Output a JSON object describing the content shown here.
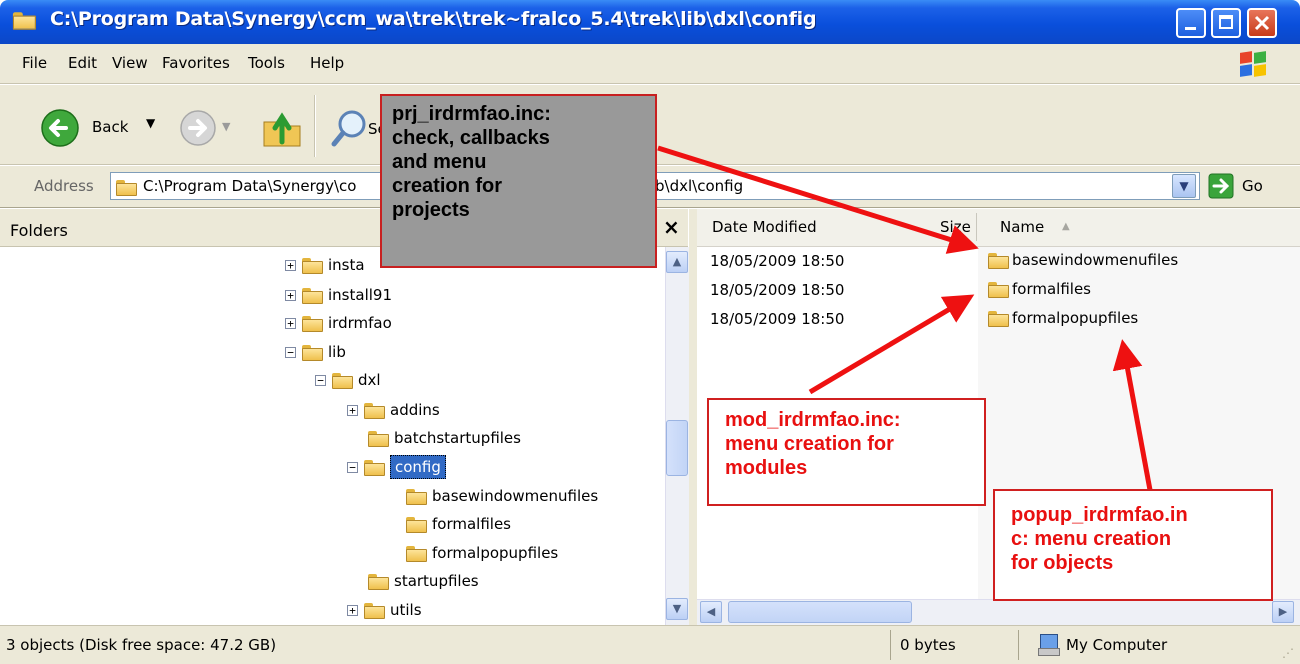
{
  "window": {
    "title": "C:\\Program Data\\Synergy\\ccm_wa\\trek\\trek~fralco_5.4\\trek\\lib\\dxl\\config"
  },
  "menu": [
    "File",
    "Edit",
    "View",
    "Favorites",
    "Tools",
    "Help"
  ],
  "toolbar": {
    "back_label": "Back",
    "search_label": "Se"
  },
  "address": {
    "label": "Address",
    "value": "C:\\Program Data\\Synergy\\co",
    "value_tail": "b\\dxl\\config",
    "go_label": "Go"
  },
  "folders_pane": {
    "header": "Folders",
    "close": "×",
    "tree": [
      {
        "label": "insta",
        "expander": "+"
      },
      {
        "label": "install91",
        "expander": "+"
      },
      {
        "label": "irdrmfao",
        "expander": "+"
      },
      {
        "label": "lib",
        "expander": "−"
      },
      {
        "label": "dxl",
        "expander": "−"
      },
      {
        "label": "addins",
        "expander": "+"
      },
      {
        "label": "batchstartupfiles",
        "expander": ""
      },
      {
        "label": "config",
        "expander": "−",
        "selected": true
      },
      {
        "label": "basewindowmenufiles",
        "expander": ""
      },
      {
        "label": "formalfiles",
        "expander": ""
      },
      {
        "label": "formalpopupfiles",
        "expander": ""
      },
      {
        "label": "startupfiles",
        "expander": ""
      },
      {
        "label": "utils",
        "expander": "+"
      }
    ]
  },
  "file_list": {
    "columns": {
      "date": "Date Modified",
      "size": "Size",
      "name": "Name"
    },
    "sort_indicator": "▲",
    "rows": [
      {
        "date": "18/05/2009 18:50",
        "name": "basewindowmenufiles"
      },
      {
        "date": "18/05/2009 18:50",
        "name": "formalfiles"
      },
      {
        "date": "18/05/2009 18:50",
        "name": "formalpopupfiles"
      }
    ]
  },
  "status": {
    "objects": "3 objects (Disk free space: 47.2 GB)",
    "size": "0 bytes",
    "zone": "My Computer"
  },
  "callouts": {
    "prj": [
      "prj_irdrmfao.inc:",
      "check, callbacks",
      "and menu",
      "creation for",
      "projects"
    ],
    "mod": [
      "mod_irdrmfao.inc:",
      "menu creation for",
      "modules"
    ],
    "popup": [
      "popup_irdrmfao.in",
      "c: menu creation",
      "for objects"
    ]
  },
  "colors": {
    "annotation_red": "#ee1111",
    "titlebar_blue": "#0a4fdc",
    "selection_blue": "#316ac5"
  }
}
